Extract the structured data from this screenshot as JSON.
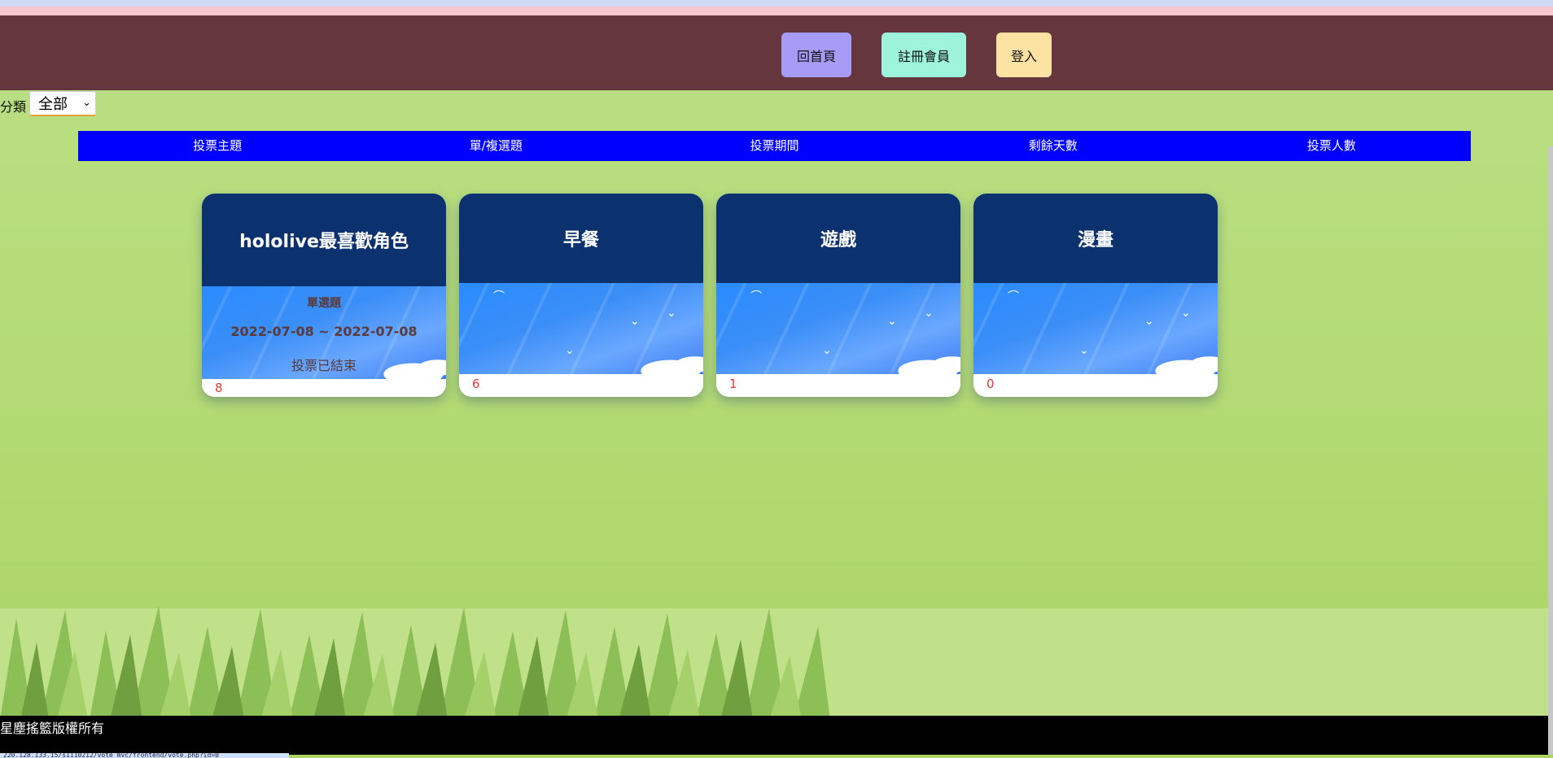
{
  "nav": {
    "home_label": "回首頁",
    "register_label": "註冊會員",
    "login_label": "登入"
  },
  "filter": {
    "label": "分類",
    "selected": "全部"
  },
  "table_header": [
    "投票主題",
    "單/複選題",
    "投票期間",
    "剩餘天數",
    "投票人數"
  ],
  "cards": [
    {
      "title": "hololive最喜歡角色",
      "type": "單選題",
      "period": "2022-07-08 ~ 2022-07-08",
      "status": "投票已結束",
      "voters": "8"
    },
    {
      "title": "早餐",
      "voters": "6"
    },
    {
      "title": "遊戲",
      "voters": "1"
    },
    {
      "title": "漫畫",
      "voters": "0"
    }
  ],
  "footer": {
    "copyright": "星塵搖籃版權所有"
  },
  "status_bar": {
    "url": "220.128.133.15/s1110212/vote_mvc/frontend/vote.php?id=0"
  }
}
